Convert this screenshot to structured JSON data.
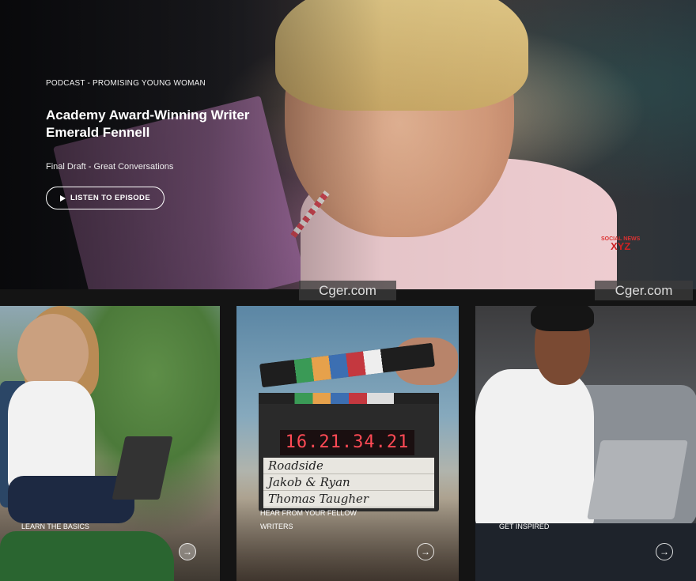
{
  "hero": {
    "kicker": "PODCAST - PROMISING YOUNG WOMAN",
    "title": "Academy Award-Winning Writer Emerald Fennell",
    "subtitle": "Final Draft - Great Conversations",
    "button_label": "LISTEN TO EPISODE",
    "button_icon": "play-icon"
  },
  "watermarks": {
    "center": "Cger.com",
    "right": "Cger.com",
    "logo_top": "SOCIAL NEWS",
    "logo_main": "XYZ"
  },
  "clapperboard": {
    "timecode": "16.21.34.21",
    "lines": [
      "Roadside",
      "Jakob & Ryan",
      "Thomas Taugher"
    ]
  },
  "cards": [
    {
      "label": "LEARN THE BASICS",
      "arrow_icon": "arrow-right-icon"
    },
    {
      "label_line1": "HEAR FROM YOUR FELLOW",
      "label_line2": "WRITERS",
      "arrow_icon": "arrow-right-icon"
    },
    {
      "label": "GET INSPIRED",
      "arrow_icon": "arrow-right-icon"
    }
  ],
  "colors": {
    "page_background": "#141414",
    "text": "#ffffff"
  }
}
